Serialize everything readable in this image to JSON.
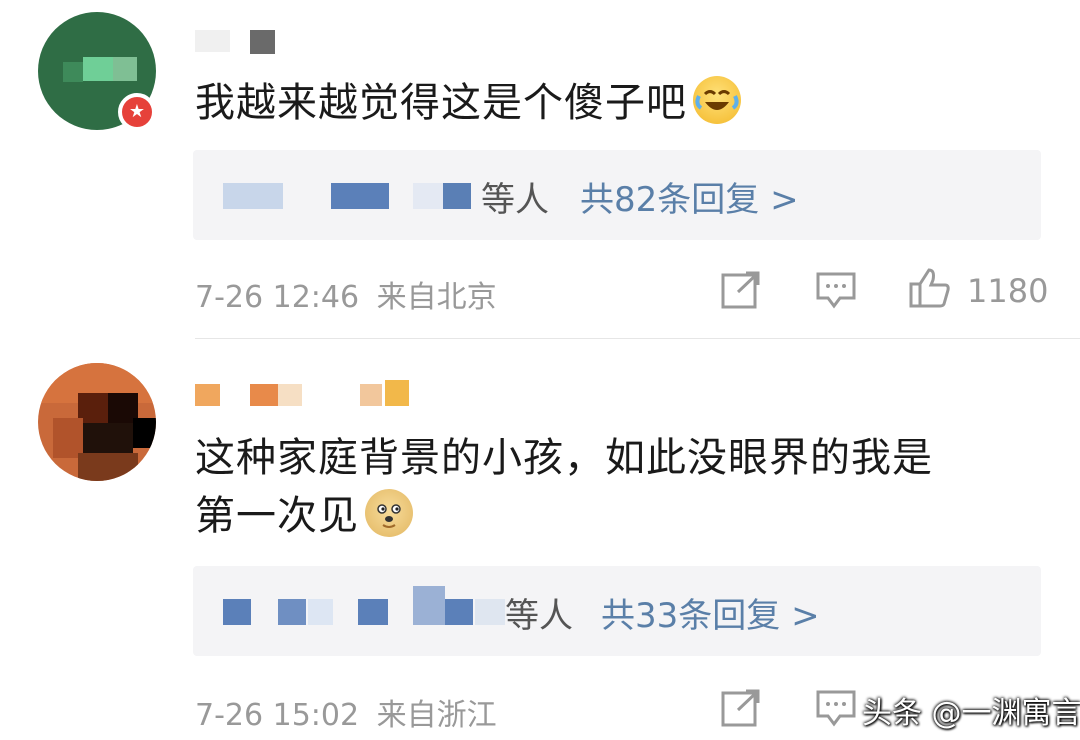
{
  "comments": [
    {
      "text": "我越来越觉得这是个傻子吧",
      "emoji": "laughing-crying-emoji",
      "reply_who": "等人",
      "reply_count": "共82条回复 >",
      "timestamp": "7-26 12:46",
      "location": "来自北京",
      "likes": "1180"
    },
    {
      "text_line1": "这种家庭背景的小孩，如此没眼界的我是",
      "text_line2": "第一次见",
      "emoji": "doge-emoji",
      "reply_who": "等人",
      "reply_count": "共33条回复 >",
      "timestamp": "7-26 15:02",
      "location": "来自浙江"
    }
  ],
  "watermark": "头条 @一渊寓言",
  "colors": {
    "link": "#5a7fa8",
    "meta": "#999999",
    "reply_bg": "#f4f4f6",
    "badge": "#e6413a"
  }
}
